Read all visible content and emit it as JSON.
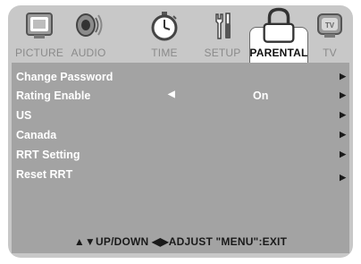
{
  "tabs": [
    {
      "label": "PICTURE",
      "icon": "picture-icon",
      "active": false
    },
    {
      "label": "AUDIO",
      "icon": "speaker-icon",
      "active": false
    },
    {
      "label": "TIME",
      "icon": "stopwatch-icon",
      "active": false
    },
    {
      "label": "SETUP",
      "icon": "tools-icon",
      "active": false
    },
    {
      "label": "PARENTAL",
      "icon": "lock-icon",
      "active": true
    },
    {
      "label": "TV",
      "icon": "tv-icon",
      "active": false
    }
  ],
  "menu": {
    "rows": [
      {
        "label": "Change Password",
        "value": ""
      },
      {
        "label": "Rating Enable",
        "value": "On"
      },
      {
        "label": "US",
        "value": ""
      },
      {
        "label": "Canada",
        "value": ""
      },
      {
        "label": "RRT Setting",
        "value": ""
      },
      {
        "label": "Reset RRT",
        "value": ""
      }
    ],
    "left_arrow": "◀",
    "right_arrow": "▶"
  },
  "footer": {
    "text": "▲▼UP/DOWN  ◀▶ADJUST  \"MENU\":EXIT"
  },
  "colors": {
    "frame": "#c8c8c8",
    "panel": "#a3a3a3",
    "active_tab": "#ffffff",
    "row_text": "#ffffff"
  }
}
